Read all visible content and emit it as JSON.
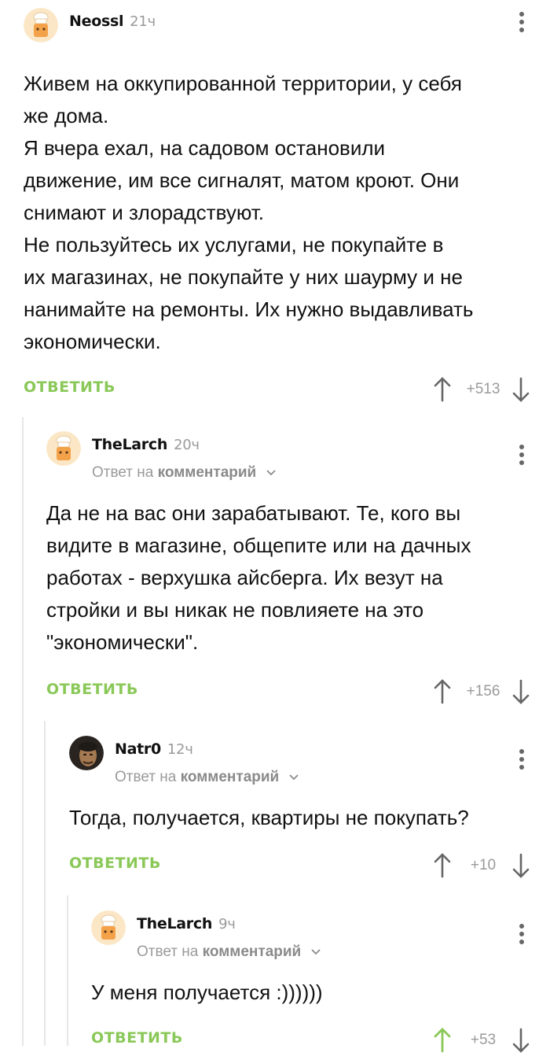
{
  "comments": [
    {
      "author": "Neossl",
      "time": "21ч",
      "reply_to": null,
      "text": "Живем на оккупированной территории, у себя\nже дома.\nЯ вчера ехал, на садовом остановили\nдвижение, им все сигналят, матом кроют. Они\nснимают и злорадствуют.\nНе пользуйтесь их услугами, не покупайте в\nих магазинах, не покупайте у них шаурму и не\nнанимайте на ремонты. Их нужно выдавливать\nэкономически.",
      "reply_label": "ОТВЕТИТЬ",
      "score": "+513",
      "avatar": "chef-avatar"
    },
    {
      "author": "TheLarch",
      "time": "20ч",
      "reply_to": {
        "prefix": "Ответ на",
        "target": "комментарий"
      },
      "text": "Да не на вас они зарабатывают. Те, кого вы\nвидите в магазине, общепите или на дачных\nработах - верхушка айсберга. Их везут на\nстройки и вы никак не повлияете на это\n\"экономически\".",
      "reply_label": "ОТВЕТИТЬ",
      "score": "+156",
      "avatar": "chef-avatar"
    },
    {
      "author": "Natr0",
      "time": "12ч",
      "reply_to": {
        "prefix": "Ответ на",
        "target": "комментарий"
      },
      "text": "Тогда, получается, квартиры не покупать?",
      "reply_label": "ОТВЕТИТЬ",
      "score": "+10",
      "avatar": "photo-avatar"
    },
    {
      "author": "TheLarch",
      "time": "9ч",
      "reply_to": {
        "prefix": "Ответ на",
        "target": "комментарий"
      },
      "text": "У меня получается :))))))",
      "reply_label": "ОТВЕТИТЬ",
      "score": "+53",
      "avatar": "chef-avatar",
      "upvoted": true
    }
  ],
  "colors": {
    "accent_green": "#8ac858",
    "muted_gray": "#9a9a9a",
    "thread_line": "#e6e6e6"
  }
}
